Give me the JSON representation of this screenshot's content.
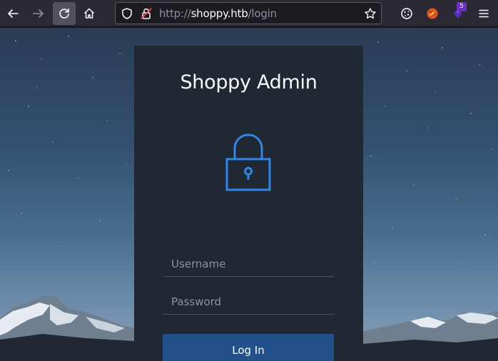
{
  "browser": {
    "url_scheme": "http://",
    "url_host": "shoppy.htb",
    "url_path": "/login",
    "extension_badge": "5"
  },
  "login": {
    "title": "Shoppy Admin",
    "username_placeholder": "Username",
    "password_placeholder": "Password",
    "button_label": "Log In"
  },
  "colors": {
    "card_background": "#1f2833",
    "accent_blue": "#2f86e8",
    "button": "#22508a"
  }
}
